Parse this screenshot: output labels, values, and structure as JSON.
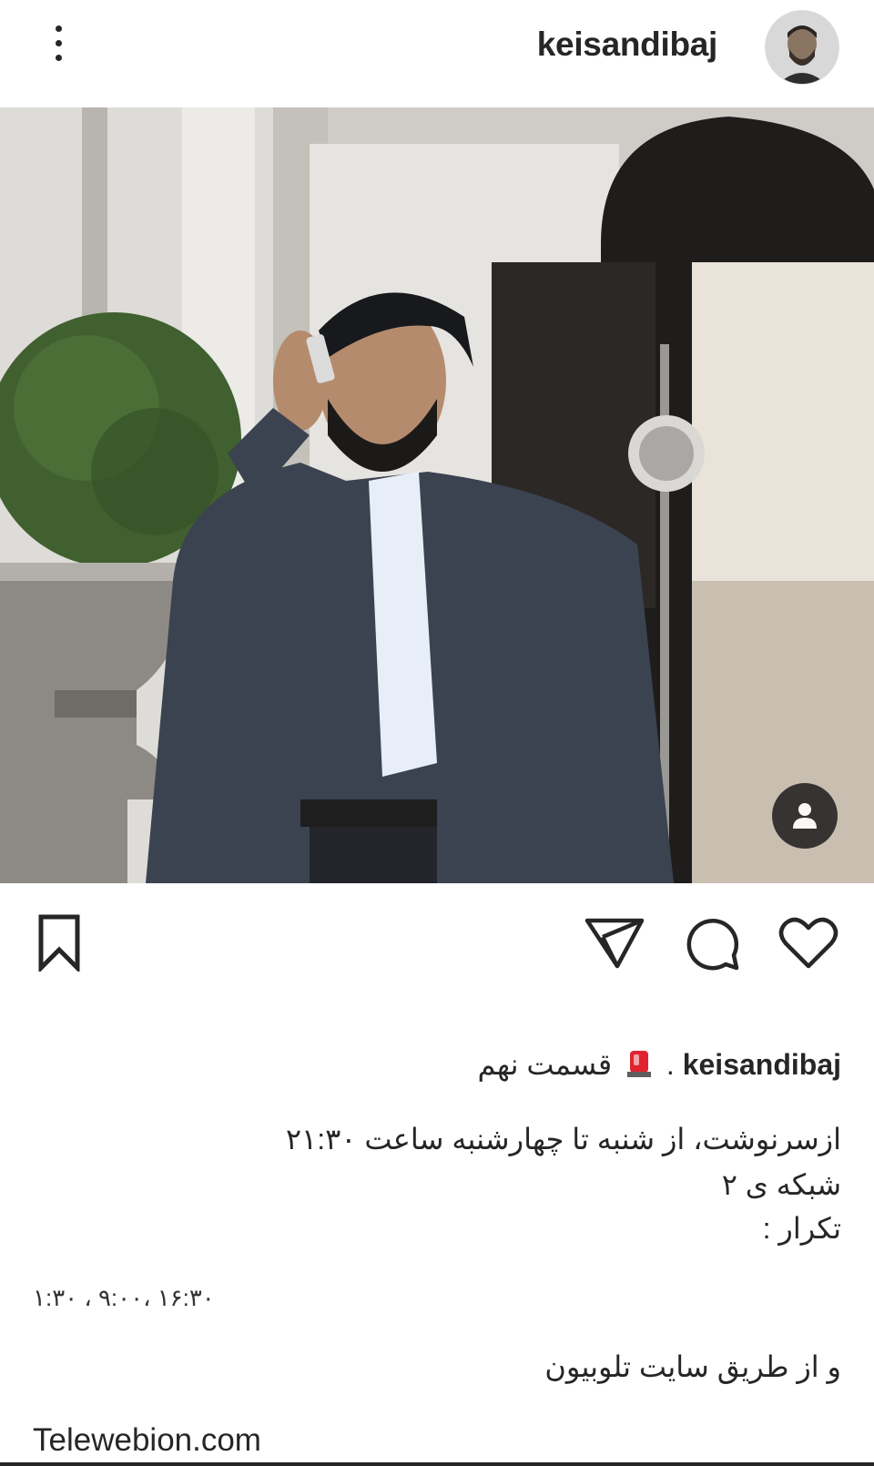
{
  "post": {
    "username": "keisandibaj",
    "caption": {
      "username": "keisandibaj",
      "separator": ".",
      "title": "قسمت نهم",
      "line1": "ازسرنوشت، از شنبه تا چهارشنبه ساعت ۲۱:۳۰",
      "line2": "شبکه ی ۲",
      "line3": "تکرار :",
      "times": "۱:۳۰ ، ۹:۰۰، ۱۶:۳۰",
      "line4": "و از طریق سایت تلوبیون",
      "site": "Telewebion.com"
    }
  },
  "icons": {
    "more": "more-vertical-icon",
    "save": "bookmark-icon",
    "share": "paper-plane-icon",
    "comment": "comment-bubble-icon",
    "like": "heart-icon",
    "tag": "user-tag-icon",
    "siren": "police-light-emoji"
  },
  "colors": {
    "text": "#262626",
    "background": "#ffffff",
    "tag_badge": "#262626",
    "siren_red": "#e0242f"
  }
}
